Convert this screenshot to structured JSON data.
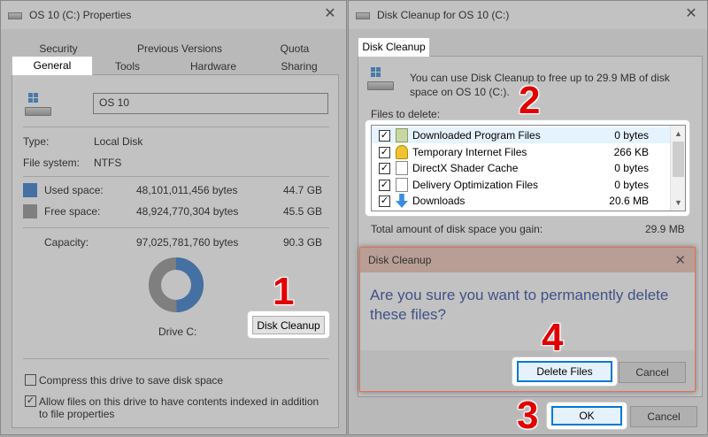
{
  "properties": {
    "title": "OS 10 (C:) Properties",
    "tabs_top": [
      "Security",
      "Previous Versions",
      "Quota"
    ],
    "tabs_bottom": [
      "General",
      "Tools",
      "Hardware",
      "Sharing"
    ],
    "drive_name": "OS 10",
    "type_label": "Type:",
    "type_value": "Local Disk",
    "fs_label": "File system:",
    "fs_value": "NTFS",
    "used_label": "Used space:",
    "used_bytes": "48,101,011,456 bytes",
    "used_gb": "44.7 GB",
    "free_label": "Free space:",
    "free_bytes": "48,924,770,304 bytes",
    "free_gb": "45.5 GB",
    "capacity_label": "Capacity:",
    "capacity_bytes": "97,025,781,760 bytes",
    "capacity_gb": "90.3 GB",
    "drive_label": "Drive C:",
    "disk_cleanup_button": "Disk Cleanup",
    "compress_label": "Compress this drive to save disk space",
    "index_label": "Allow files on this drive to have contents indexed in addition to file properties",
    "used_fraction": 0.496,
    "used_color": "#2672c8",
    "free_color": "#8c8c8c"
  },
  "cleanup": {
    "title": "Disk Cleanup for OS 10 (C:)",
    "tab": "Disk Cleanup",
    "intro": "You can use Disk Cleanup to free up to 29.9 MB of disk space on OS 10 (C:).",
    "files_label": "Files to delete:",
    "files": [
      {
        "name": "Downloaded Program Files",
        "size": "0 bytes",
        "checked": "✓"
      },
      {
        "name": "Temporary Internet Files",
        "size": "266 KB",
        "checked": "✓"
      },
      {
        "name": "DirectX Shader Cache",
        "size": "0 bytes",
        "checked": "✓"
      },
      {
        "name": "Delivery Optimization Files",
        "size": "0 bytes",
        "checked": "✓"
      },
      {
        "name": "Downloads",
        "size": "20.6 MB",
        "checked": "✓"
      }
    ],
    "total_label": "Total amount of disk space you gain:",
    "total_value": "29.9 MB",
    "ok_button": "OK",
    "cancel_button": "Cancel"
  },
  "confirm": {
    "title": "Disk Cleanup",
    "question": "Are you sure you want to permanently delete these files?",
    "delete_button": "Delete Files",
    "cancel_button": "Cancel"
  },
  "steps": [
    "1",
    "2",
    "3",
    "4"
  ]
}
